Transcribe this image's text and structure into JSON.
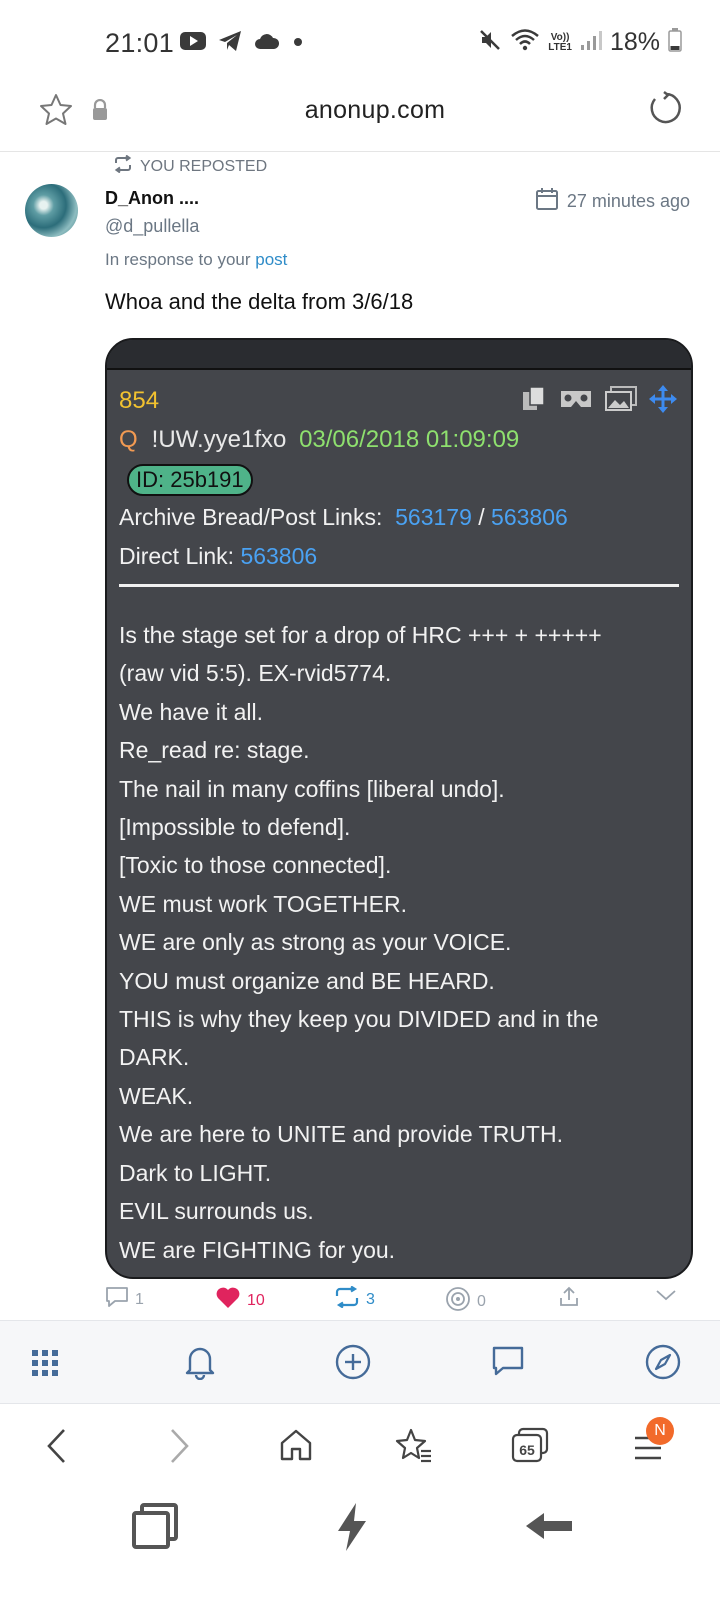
{
  "status": {
    "time": "21:01",
    "battery": "18%",
    "lte_top": "Vo))",
    "lte_bottom": "LTE1",
    "icons": [
      "youtube-icon",
      "telegram-icon",
      "cloud-icon",
      "dot-icon",
      "mute-icon",
      "wifi-icon",
      "signal-icon",
      "battery-icon"
    ]
  },
  "browser": {
    "url": "anonup.com"
  },
  "post": {
    "repost_label": "YOU REPOSTED",
    "author_name": "D_Anon ....",
    "author_handle": "@d_pullella",
    "time_ago": "27 minutes ago",
    "in_response_prefix": "In response to your",
    "in_response_link": "post",
    "text": "Whoa and the delta from 3/6/18"
  },
  "card": {
    "number": "854",
    "q": "Q",
    "tripcode": "!UW.yye1fxo",
    "date": "03/06/2018 01:09:09",
    "id": "ID: 25b191",
    "archive_label": "Archive Bread/Post Links:",
    "archive_link1": "563179",
    "archive_sep": "/",
    "archive_link2": "563806",
    "direct_label": "Direct Link:",
    "direct_link": "563806",
    "lines": [
      "Is the stage set for a drop of HRC +++ + +++++",
      "(raw vid 5:5). EX-rvid5774.",
      "We have it all.",
      "Re_read re: stage.",
      "The nail in many coffins [liberal undo].",
      "[Impossible to defend].",
      "[Toxic to those connected].",
      "WE must work TOGETHER.",
      "WE are only as strong as your VOICE.",
      "YOU must organize and BE HEARD.",
      "THIS is why they keep you DIVIDED and in the",
      "DARK.",
      "WEAK.",
      "We are here to UNITE and provide TRUTH.",
      "Dark to LIGHT.",
      "EVIL surrounds us.",
      "WE are FIGHTING for you."
    ]
  },
  "actions": {
    "comments": "1",
    "likes": "10",
    "reposts": "3",
    "points": "0"
  },
  "browser_toolbar": {
    "tabs_count": "65",
    "menu_badge": "N"
  },
  "colors": {
    "link": "#2f8cc8",
    "like": "#e0245e",
    "repost": "#2f8cc8",
    "card_bg": "#44464b",
    "card_number": "#f2c230",
    "card_date": "#8ee06e",
    "card_link": "#4aa2f3",
    "badge": "#f26a2a"
  }
}
